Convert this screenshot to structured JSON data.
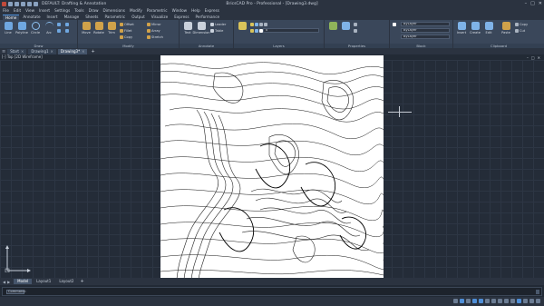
{
  "titlebar": {
    "workspace": "DEFAULT: Drafting & Annotation",
    "title": "BricsCAD Pro - Professional - [Drawing3.dwg]",
    "controls": [
      "–",
      "□",
      "✕"
    ]
  },
  "menubar": [
    "File",
    "Edit",
    "View",
    "Insert",
    "Settings",
    "Tools",
    "Draw",
    "Dimensions",
    "Modify",
    "Parametric",
    "Window",
    "Help",
    "Express"
  ],
  "ribbon_tabs": [
    "Home",
    "Annotate",
    "Insert",
    "Manage",
    "Sheets",
    "Parametric",
    "Output",
    "Visualize",
    "Express",
    "Performance"
  ],
  "ribbon": {
    "groups": [
      {
        "title": "Draw"
      },
      {
        "title": "Modify"
      },
      {
        "title": "Annotate"
      },
      {
        "title": "Layers"
      },
      {
        "title": "Properties"
      },
      {
        "title": "Block"
      },
      {
        "title": "Clipboard"
      }
    ],
    "draw_buttons": [
      "Line",
      "Polyline",
      "Circle",
      "Arc"
    ],
    "modify_buttons": [
      "Move",
      "Rotate",
      "Trim",
      "Offset",
      "Fillet",
      "Copy",
      "Mirror",
      "Array",
      "Stretch",
      "Scale"
    ],
    "annotate_buttons": [
      "Text",
      "Dimension",
      "Leader",
      "Table"
    ],
    "layer_value": "0",
    "props": {
      "color": "ByLayer",
      "linetype": "ByLayer",
      "lineweight": "ByLayer"
    },
    "block_buttons": [
      "Insert",
      "Create",
      "Edit"
    ],
    "clipboard_buttons": [
      "Paste",
      "Copy",
      "Cut"
    ]
  },
  "doc_tabs": [
    {
      "label": "Start",
      "active": false
    },
    {
      "label": "Drawing1",
      "active": false
    },
    {
      "label": "Drawing3*",
      "active": true
    }
  ],
  "view_header": "[-] Top [2D Wireframe]",
  "view_controls": [
    "–",
    "□",
    "✕"
  ],
  "layout_tabs": [
    {
      "label": "Model",
      "active": true
    },
    {
      "label": "Layout1",
      "active": false
    },
    {
      "label": "Layout2",
      "active": false
    }
  ],
  "command": {
    "placeholder": "Command:"
  },
  "status": {
    "text": ""
  },
  "colors": {
    "accent": "#4f8fd8",
    "canvas": "#242c38",
    "ribbon": "#3a475a"
  }
}
